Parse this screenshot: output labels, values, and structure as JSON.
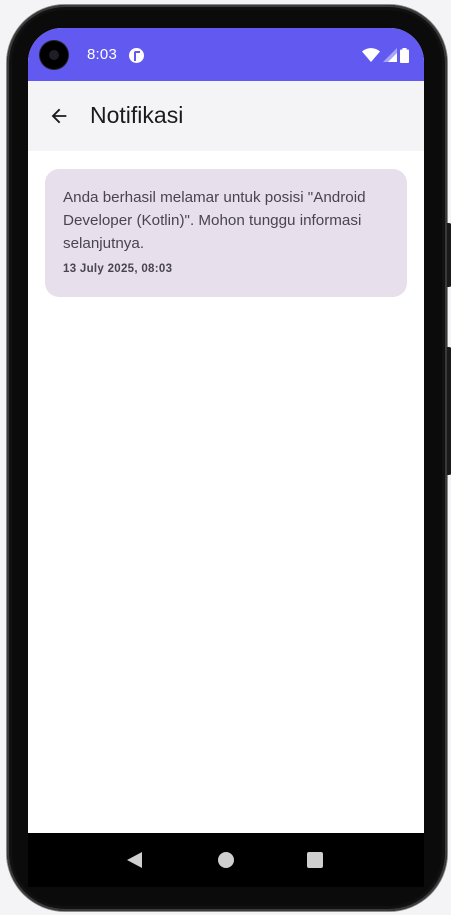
{
  "status_bar": {
    "time": "8:03",
    "background_color": "#6259f0",
    "app_icon": "notification-app-icon",
    "icons": [
      "wifi-icon",
      "cellular-signal-icon",
      "battery-icon"
    ]
  },
  "app_bar": {
    "title": "Notifikasi",
    "back_icon": "arrow-back-icon"
  },
  "notifications": [
    {
      "message": "Anda berhasil melamar untuk posisi \"Android Developer (Kotlin)\". Mohon tunggu informasi selanjutnya.",
      "timestamp": "13 July 2025, 08:03",
      "card_color": "#e7dfec"
    }
  ],
  "nav_bar": {
    "buttons": [
      "nav-back-icon",
      "nav-home-icon",
      "nav-recents-icon"
    ]
  }
}
